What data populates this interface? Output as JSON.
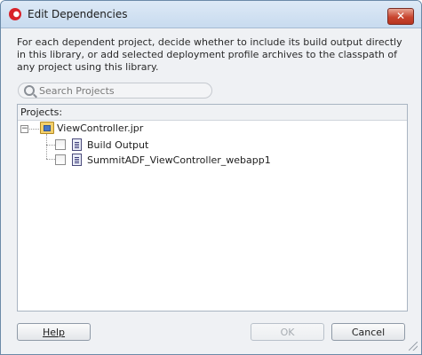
{
  "window": {
    "title": "Edit Dependencies",
    "close_glyph": "✕"
  },
  "description": "For each dependent project, decide whether to include its build output directly in this library, or add selected deployment profile archives to the classpath of any project using this library.",
  "search": {
    "placeholder": "Search Projects",
    "value": ""
  },
  "projects_panel": {
    "label": "Projects:",
    "tree": {
      "root": {
        "label": "ViewController.jpr",
        "expander_glyph": "−",
        "expanded": true,
        "icon": "folder-icon",
        "children": [
          {
            "label": "Build Output",
            "checked": false,
            "icon": "document-icon"
          },
          {
            "label": "SummitADF_ViewController_webapp1",
            "checked": false,
            "icon": "document-icon"
          }
        ]
      }
    }
  },
  "buttons": {
    "help": "Help",
    "ok": "OK",
    "ok_enabled": false,
    "cancel": "Cancel"
  },
  "colors": {
    "window_bg": "#eff1f4",
    "titlebar": "#c8dbef",
    "close_button": "#c8452f"
  }
}
